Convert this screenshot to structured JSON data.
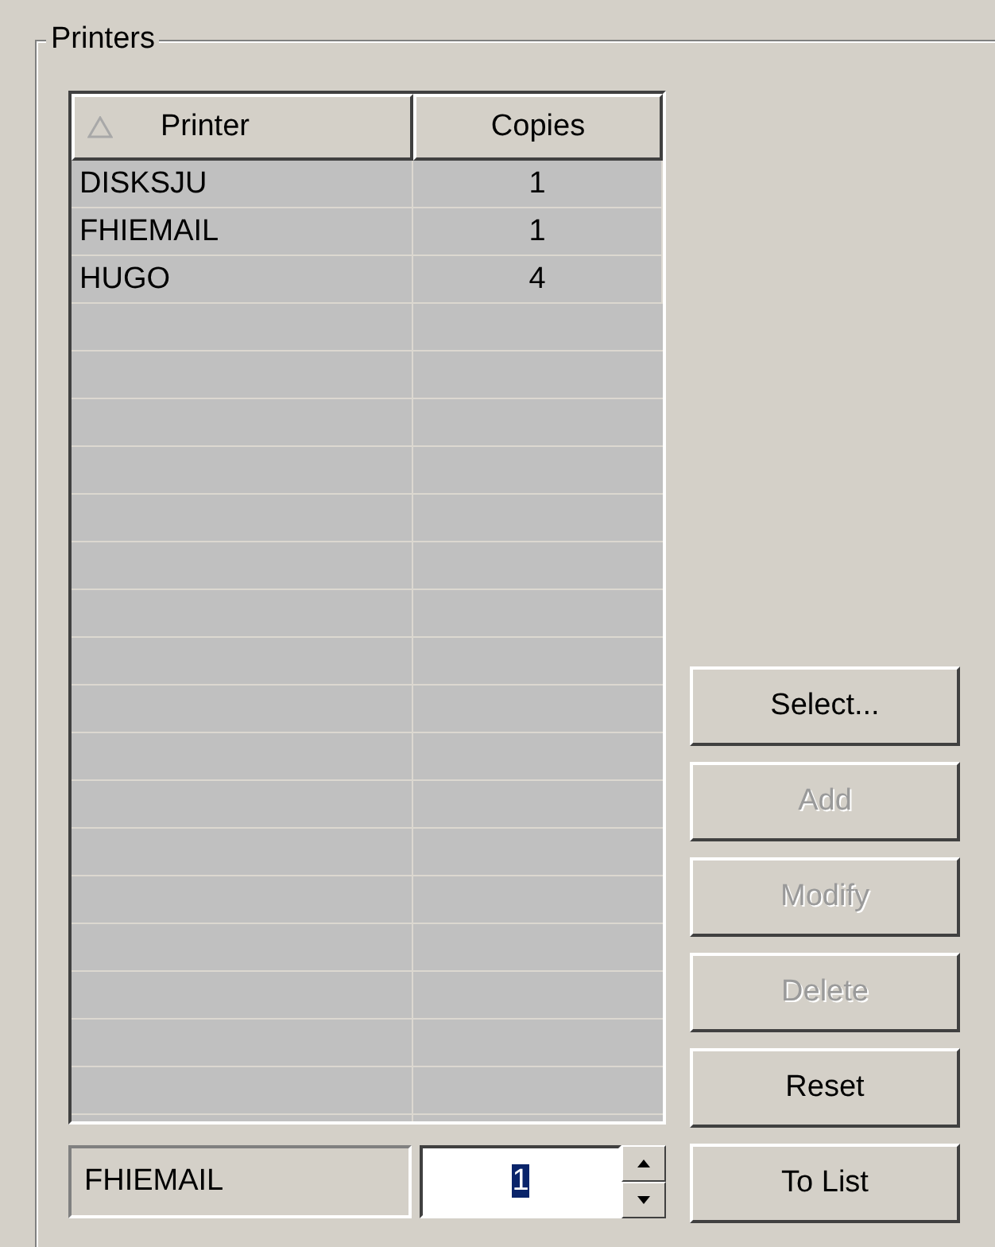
{
  "group": {
    "title": "Printers"
  },
  "table": {
    "columns": [
      {
        "label": "Printer",
        "sorted": true
      },
      {
        "label": "Copies",
        "sorted": false
      }
    ],
    "rows": [
      {
        "printer": "DISKSJU",
        "copies": "1"
      },
      {
        "printer": "FHIEMAIL",
        "copies": "1"
      },
      {
        "printer": "HUGO",
        "copies": "4"
      }
    ]
  },
  "name_field": {
    "value": "FHIEMAIL"
  },
  "copies_spinner": {
    "value": "1",
    "value_selected": true
  },
  "buttons": [
    {
      "label": "Select...",
      "disabled": false
    },
    {
      "label": "Add",
      "disabled": true
    },
    {
      "label": "Modify",
      "disabled": true
    },
    {
      "label": "Delete",
      "disabled": true
    },
    {
      "label": "Reset",
      "disabled": false
    },
    {
      "label": "To List",
      "disabled": false
    }
  ]
}
